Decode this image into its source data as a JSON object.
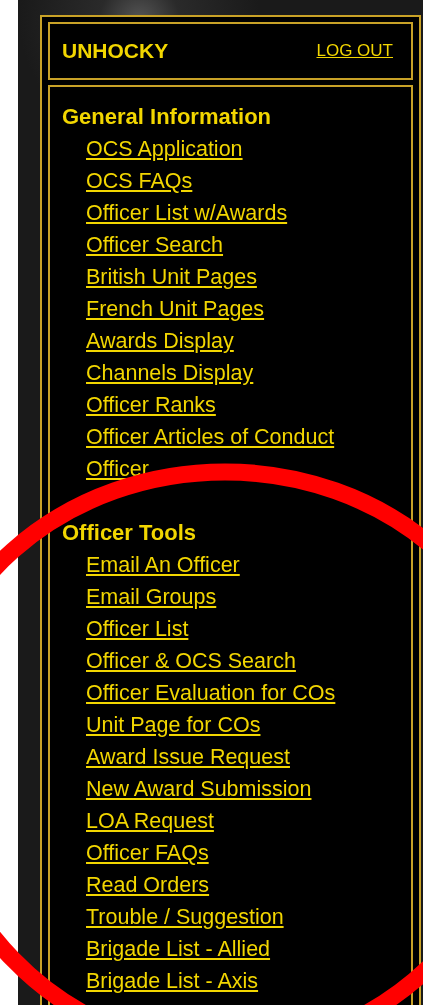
{
  "header": {
    "username": "UNHOCKY",
    "logout": "LOG OUT"
  },
  "sections": [
    {
      "title": "General Information",
      "links": [
        "OCS Application",
        "OCS FAQs",
        "Officer List w/Awards",
        "Officer Search",
        "British Unit Pages",
        "French Unit Pages",
        "Awards Display",
        "Channels Display",
        "Officer Ranks",
        "Officer Articles of Conduct",
        "Officer"
      ]
    },
    {
      "title": "Officer Tools",
      "links": [
        "Email An Officer",
        "Email Groups",
        "Officer List",
        "Officer & OCS Search",
        "Officer Evaluation for COs",
        "Unit Page for COs",
        "Award Issue Request",
        "New Award Submission",
        "LOA Request",
        "Officer FAQs",
        "Read Orders",
        "Trouble / Suggestion",
        "Brigade List - Allied",
        "Brigade List - Axis"
      ]
    }
  ],
  "annotation": {
    "kind": "ring",
    "color": "#ff0000"
  }
}
